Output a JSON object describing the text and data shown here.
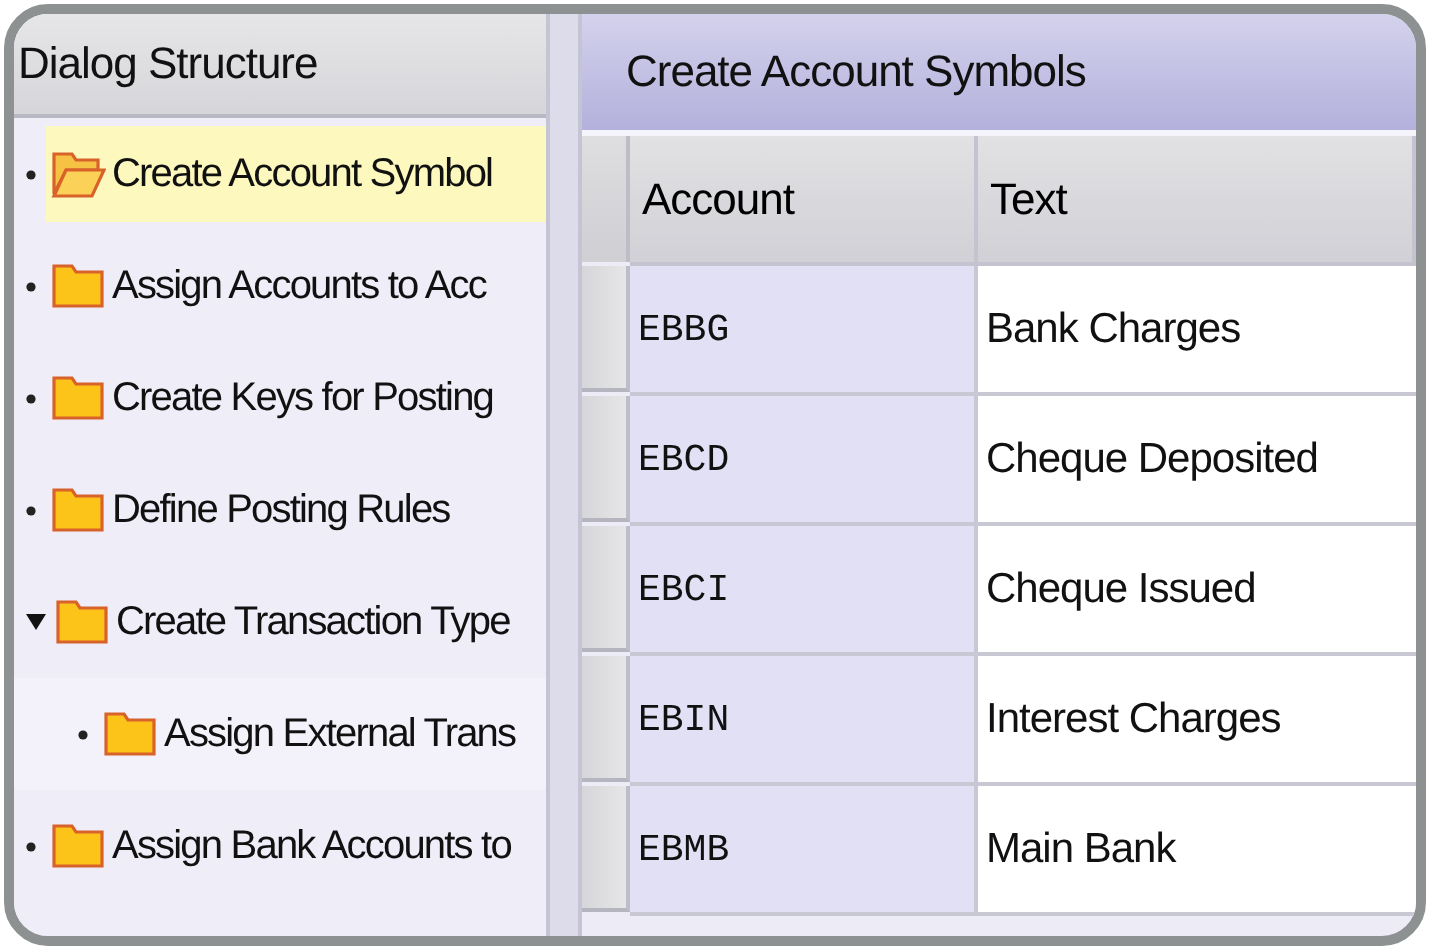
{
  "dialog_structure": {
    "title": "Dialog Structure",
    "items": [
      {
        "label": "Create Account Symbol",
        "selected": true
      },
      {
        "label": "Assign Accounts to Acc",
        "selected": false
      },
      {
        "label": "Create Keys for Posting",
        "selected": false
      },
      {
        "label": "Define Posting Rules",
        "selected": false
      },
      {
        "label": "Create Transaction Type",
        "selected": false,
        "expanded": true,
        "children": [
          {
            "label": "Assign External Trans",
            "selected": false
          }
        ]
      },
      {
        "label": "Assign Bank Accounts to",
        "selected": false
      }
    ]
  },
  "content": {
    "title": "Create Account Symbols",
    "table": {
      "columns": [
        "Account",
        "Text"
      ],
      "rows": [
        {
          "account": "EBBG",
          "text": "Bank Charges"
        },
        {
          "account": "EBCD",
          "text": "Cheque Deposited"
        },
        {
          "account": "EBCI",
          "text": "Cheque Issued"
        },
        {
          "account": "EBIN",
          "text": "Interest Charges"
        },
        {
          "account": "EBMB",
          "text": "Main Bank"
        }
      ]
    }
  }
}
